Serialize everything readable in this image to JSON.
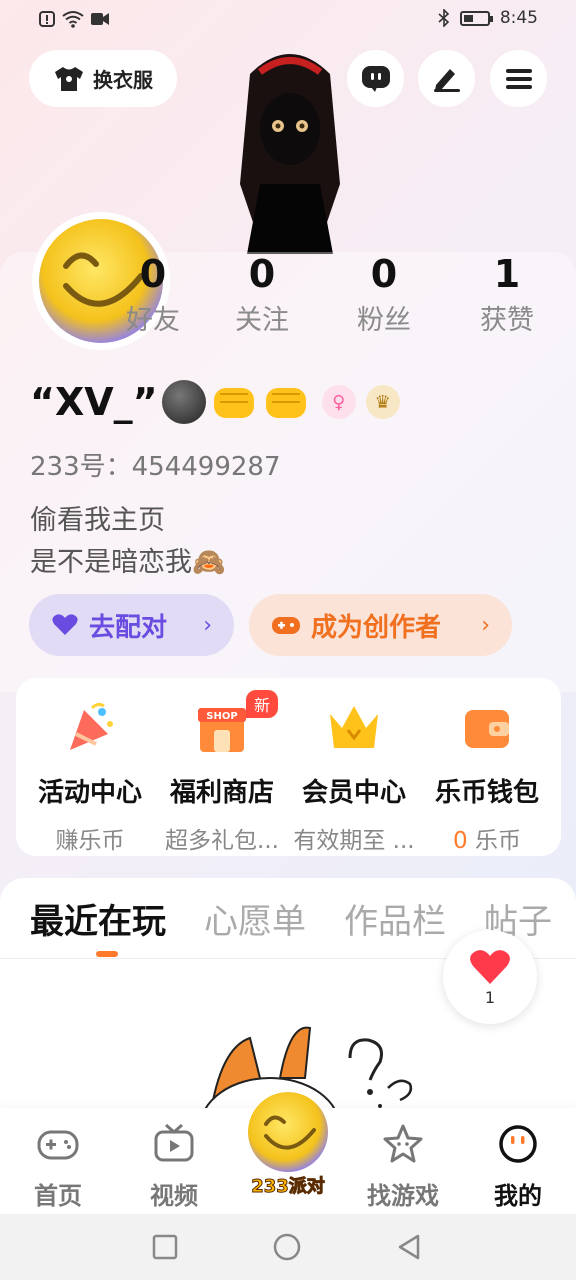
{
  "status_bar": {
    "time": "8:45",
    "left_icons": [
      "alert-icon",
      "wifi-icon",
      "video-icon"
    ],
    "right_icons": [
      "bluetooth-icon",
      "battery-icon"
    ],
    "battery_level": 0.4
  },
  "top_buttons": {
    "outfit_label": "换衣服",
    "icons": [
      "chat-icon",
      "edit-icon",
      "menu-icon"
    ]
  },
  "stats": [
    {
      "value": "0",
      "label": "好友"
    },
    {
      "value": "0",
      "label": "关注"
    },
    {
      "value": "0",
      "label": "粉丝"
    },
    {
      "value": "1",
      "label": "获赞"
    }
  ],
  "profile": {
    "username": "“XV_”",
    "uid": "233号：454499287",
    "bio_line1": "偷看我主页",
    "bio_line2": "是不是暗恋我🙈"
  },
  "actions": {
    "match_label": "去配对",
    "creator_label": "成为创作者"
  },
  "services": [
    {
      "title": "活动中心",
      "subtitle": "赚乐币",
      "icon": "party-popper-icon"
    },
    {
      "title": "福利商店",
      "subtitle": "超多礼包...",
      "icon": "shop-icon",
      "badge": "新",
      "shop_text": "SHOP"
    },
    {
      "title": "会员中心",
      "subtitle": "有效期至 ...",
      "icon": "crown-icon"
    },
    {
      "title": "乐币钱包",
      "subtitle_count": "0",
      "subtitle_unit": "乐币",
      "icon": "wallet-icon"
    }
  ],
  "tabs": [
    "最近在玩",
    "心愿单",
    "作品栏",
    "帖子"
  ],
  "active_tab": 0,
  "like_bubble": {
    "count": "1"
  },
  "bottom_nav": [
    {
      "label": "首页",
      "icon": "gamepad-icon"
    },
    {
      "label": "视频",
      "icon": "tv-icon"
    },
    {
      "label": "233派对",
      "icon": "party-logo-icon"
    },
    {
      "label": "找游戏",
      "icon": "star-icon"
    },
    {
      "label": "我的",
      "icon": "face-icon"
    }
  ],
  "colors": {
    "accent_orange": "#ff7a2a",
    "match_purple": "#6a4de0",
    "creator_orange": "#f07020",
    "new_badge_red": "#ff4a3d"
  }
}
